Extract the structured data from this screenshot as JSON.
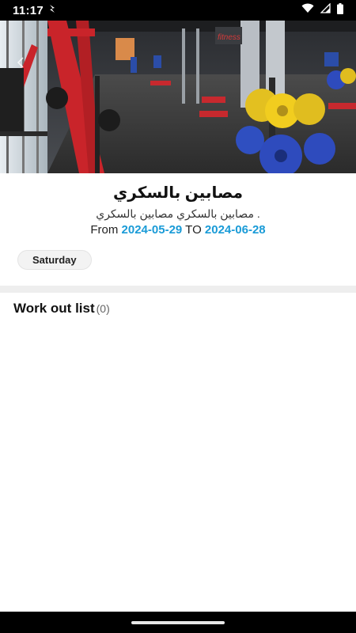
{
  "status": {
    "time": "11:17"
  },
  "plan": {
    "title": "مصابين بالسكري",
    "description": ". مصابين بالسكري مصابين بالسكري",
    "from_label": "From",
    "start_date": "2024-05-29",
    "to_label": "TO",
    "end_date": "2024-06-28",
    "day_chip": "Saturday"
  },
  "workout_list": {
    "title": "Work out list",
    "count": "(0)"
  },
  "colors": {
    "accent": "#1a9bd7",
    "divider": "#eeeeee"
  },
  "icons": [
    "app-notification-icon",
    "wifi-icon",
    "signal-icon",
    "battery-icon",
    "back-arrow-icon"
  ]
}
